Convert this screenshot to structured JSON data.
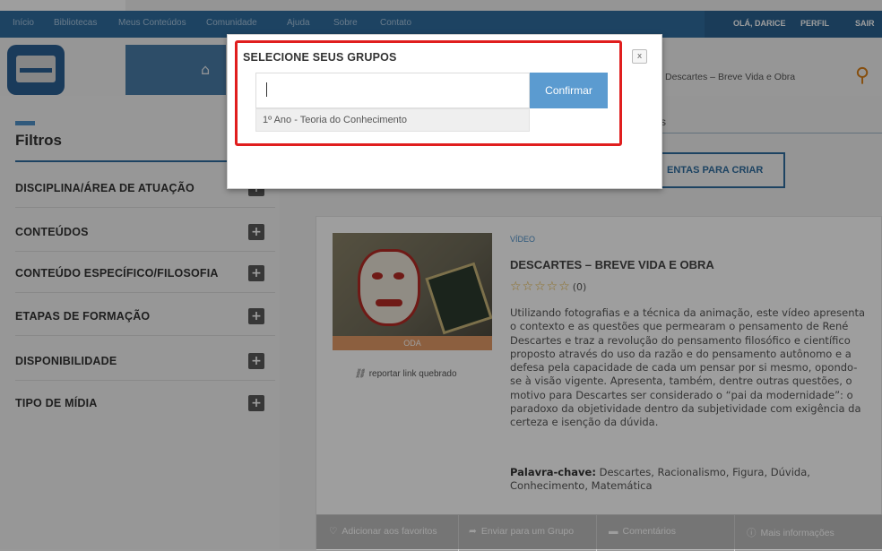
{
  "topnav": {
    "links": [
      "Início",
      "Bibliotecas",
      "Meus Conteúdos",
      "Comunidade",
      "Ajuda",
      "Sobre",
      "Contato"
    ],
    "greeting": "OLÁ, DARICE",
    "profile": "PERFIL",
    "logout": "SAIR"
  },
  "header": {
    "search_value": "Descartes – Breve Vida e Obra"
  },
  "sidebar": {
    "title": "Filtros",
    "filters": [
      {
        "label": "DISCIPLINA/ÁREA DE ATUAÇÃO",
        "icon": "plus-icon"
      },
      {
        "label": "CONTEÚDOS",
        "icon": "plus-icon"
      },
      {
        "label": "CONTEÚDO ESPECÍFICO/FILOSOFIA",
        "icon": "plus-icon"
      },
      {
        "label": "ETAPAS DE FORMAÇÃO",
        "icon": "plus-icon"
      },
      {
        "label": "DISPONIBILIDADE",
        "icon": "plus-icon"
      },
      {
        "label": "TIPO DE MÍDIA",
        "icon": "plus-icon"
      }
    ]
  },
  "content": {
    "tab_partial": "s",
    "tools_button": "ENTAS PARA CRIAR",
    "card": {
      "type": "VÍDEO",
      "tag": "ODA",
      "title": "DESCARTES – BREVE VIDA E OBRA",
      "stars": "☆☆☆☆☆",
      "rating_count": "(0)",
      "description": "Utilizando fotografias e a técnica da animação, este vídeo apresenta o contexto e as questões que permearam o pensamento de René Descartes e traz a revolução do pensamento filosófico e científico proposto através do uso da razão e do pensamento autônomo e a defesa pela capacidade de cada um pensar por si mesmo, opondo-se à visão vigente. Apresenta, também, dentre outras questões, o motivo para Descartes ser considerado o “pai da modernidade”: o paradoxo da objetividade dentro da subjetividade com exigência da certeza e isenção da dúvida.",
      "keywords_label": "Palavra-chave:",
      "keywords": "Descartes, Racionalismo, Figura, Dúvida, Conhecimento, Matemática",
      "report_link": "reportar link quebrado",
      "actions": [
        {
          "label": "Adicionar aos favoritos",
          "icon": "heart-icon"
        },
        {
          "label": "Enviar para um Grupo",
          "icon": "share-arrow-icon"
        },
        {
          "label": "Comentários",
          "icon": "comment-icon"
        },
        {
          "label": "Mais informações",
          "icon": "info-icon"
        }
      ]
    }
  },
  "modal": {
    "title": "SELECIONE SEUS GRUPOS",
    "close_label": "x",
    "input_value": "",
    "confirm_label": "Confirmar",
    "suggestion": "1º Ano - Teoria do Conhecimento"
  },
  "colors": {
    "nav_blue": "#2f6d9f",
    "accent_blue": "#5b9bd0",
    "highlight_red": "#e01e1e",
    "search_orange": "#d97e16"
  }
}
